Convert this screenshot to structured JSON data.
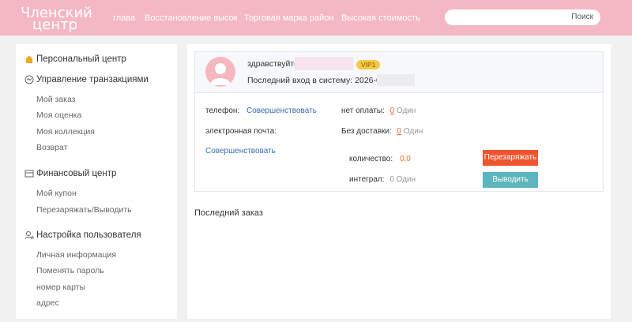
{
  "header": {
    "logo_line1": "Членский",
    "logo_line2": "центр",
    "nav": [
      "главa",
      "Восстановление высок",
      "Торговая марка район",
      "Высокая стоимость"
    ],
    "search": {
      "placeholder": "",
      "button": "Поиск"
    }
  },
  "sidebar": {
    "sections": [
      {
        "label": "Персональный центр",
        "icon": "home-icon",
        "items": []
      },
      {
        "label": "Управление транзакциями",
        "icon": "transaction-icon",
        "items": [
          "Мой заказ",
          "Моя оценка",
          "Моя коллекция",
          "Возврат"
        ]
      },
      {
        "label": "Финансовый центр",
        "icon": "finance-icon",
        "items": [
          "Мой купон",
          "Перезаряжать/Выводить"
        ]
      },
      {
        "label": "Настройка пользователя",
        "icon": "user-settings-icon",
        "items": [
          "Личная информация",
          "Поменять пароль",
          "номер карты",
          "адрес"
        ]
      }
    ]
  },
  "profile": {
    "greeting": "здравствуйте:",
    "vip": "VIP1",
    "last_login_label": "Последний вход в систему:",
    "last_login_value": "2026-09",
    "phone_label": "телефон:",
    "phone_action": "Совершенствовать",
    "email_label": "электронная почта:",
    "email_action": "Совершенствовать",
    "unpaid_label": "нет оплаты:",
    "unpaid_count": "0",
    "unpaid_unit": "Один",
    "undelivered_label": "Без доставки:",
    "undelivered_count": "0",
    "undelivered_unit": "Один",
    "quantity_label": "количество:",
    "quantity_value": "0.0",
    "integral_label": "интеграл:",
    "integral_value": "0 Один",
    "recharge_button": "Перезаряжать",
    "withdraw_button": "Выводить"
  },
  "recent_order_title": "Последний заказ",
  "colors": {
    "header": "#f4b8c4",
    "accent_orange": "#ef6c2b",
    "recharge": "#f0542f",
    "withdraw": "#5db5bd",
    "link": "#3a6fb5",
    "vip": "#f7c948"
  }
}
